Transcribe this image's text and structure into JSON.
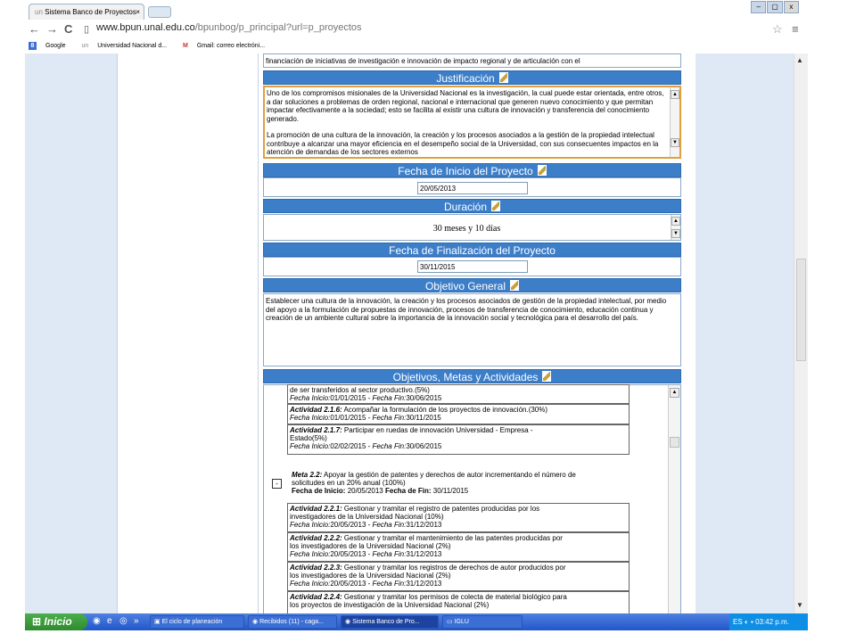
{
  "browser": {
    "tab_title": "Sistema Banco de Proyectos",
    "tab_close": "×",
    "url_host": "www.bpun.unal.edu.co",
    "url_path": "/bpunbog/p_principal?url=p_proyectos",
    "nav_back": "←",
    "nav_forward": "→",
    "nav_reload": "C",
    "star": "☆",
    "menu": "≡",
    "bookmarks": [
      {
        "label": "Google",
        "icon": "google-icon"
      },
      {
        "label": "Universidad Nacional d...",
        "icon": "un-icon"
      },
      {
        "label": "Gmail: correo electróni...",
        "icon": "gmail-icon"
      }
    ],
    "win_controls": [
      "–",
      "▢",
      "x"
    ]
  },
  "form": {
    "top_text": "financiación de iniciativas de investigación e innovación de impacto regional y de articulación con el",
    "justificacion_title": "Justificación",
    "justificacion_p1": "Uno de los compromisos misionales de la Universidad Nacional es la investigación, la cual puede estar orientada, entre otros, a dar soluciones a problemas de orden regional, nacional e internacional que generen nuevo conocimiento y que permitan impactar efectivamente a la sociedad; esto se facilita al existir una cultura de innovación y transferencia del conocimiento generado.",
    "justificacion_p2": "La promoción de una cultura de la innovación, la creación y los procesos asociados a la gestión de la propiedad intelectual contribuye a alcanzar una mayor eficiencia en el desempeño social de la Universidad, con sus consecuentes impactos en la atención de demandas de los sectores externos",
    "fecha_inicio_title": "Fecha de Inicio del Proyecto",
    "fecha_inicio": "20/05/2013",
    "duracion_title": "Duración",
    "duracion": "30 meses y 10 días",
    "fecha_fin_title": "Fecha de Finalización del Proyecto",
    "fecha_fin": "30/11/2015",
    "objetivo_title": "Objetivo General",
    "objetivo": "Establecer una cultura de la innovación, la creación y los procesos asociados de gestión de la propiedad intelectual, por medio del apoyo a la formulación de propuestas de innovación, procesos de transferencia de conocimiento, educación continua y creación de un ambiente cultural sobre la importancia de la innovación social y tecnológica para el desarrollo del país.",
    "oma_title": "Objetivos, Metas y Actividades"
  },
  "activities_top": [
    {
      "lines": [
        "de ser transferidos al sector productivo.(5%)"
      ],
      "fi": "01/01/2015",
      "ff": "30/06/2015",
      "head": ""
    },
    {
      "head": "Actividad 2.1.6:",
      "lines": [
        "Acompañar la formulación de los proyectos de innovación.(30%)"
      ],
      "fi": "01/01/2015",
      "ff": "30/11/2015"
    },
    {
      "head": "Actividad 2.1.7:",
      "lines": [
        "Participar en ruedas de innovación Universidad - Empresa -",
        "Estado(5%)"
      ],
      "fi": "02/02/2015",
      "ff": "30/06/2015"
    }
  ],
  "labels": {
    "fecha_inicio_small": "Fecha Inicio:",
    "fecha_fin_small": "Fecha Fin:",
    "fecha_inicio_meta": "Fecha de Inicio:",
    "fecha_fin_meta": "Fecha de Fin:",
    "dash": " - ",
    "collapse": "-"
  },
  "meta": {
    "head": "Meta 2.2:",
    "line1": "Apoyar la gestión de patentes y derechos de autor incrementando el número de",
    "line2": "solicitudes en un 20% anual (100%)",
    "fi": "20/05/2013",
    "ff": "30/11/2015"
  },
  "activities_bottom": [
    {
      "head": "Actividad 2.2.1:",
      "lines": [
        "Gestionar y tramitar el registro de patentes producidas por los",
        "investigadores de la Universidad Nacional (10%)"
      ],
      "fi": "20/05/2013",
      "ff": "31/12/2013"
    },
    {
      "head": "Actividad 2.2.2:",
      "lines": [
        "Gestionar y tramitar el mantenimiento de las patentes producidas por",
        "los investigadores de la Universidad Nacional (2%)"
      ],
      "fi": "20/05/2013",
      "ff": "31/12/2013"
    },
    {
      "head": "Actividad 2.2.3:",
      "lines": [
        "Gestionar y tramitar los registros de derechos de autor producidos por",
        "los investigadores de la Universidad Nacional (2%)"
      ],
      "fi": "20/05/2013",
      "ff": "31/12/2013"
    },
    {
      "head": "Actividad 2.2.4:",
      "lines": [
        "Gestionar y tramitar los permisos de colecta de material biológico para",
        "los proyectos de investigación de la Universidad Nacional (2%)"
      ],
      "fi": "",
      "ff": ""
    }
  ],
  "taskbar": {
    "start": "Inicio",
    "items": [
      "El ciclo de planeación",
      "Recibidos (11) - caga...",
      "Sistema Banco de Pro...",
      "IGLU"
    ],
    "lang": "ES",
    "clock": "03:42 p.m.",
    "more": "»"
  }
}
